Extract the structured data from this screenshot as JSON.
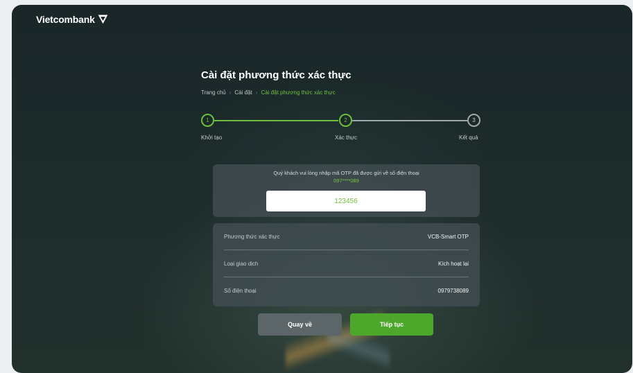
{
  "brand": {
    "name": "Vietcombank"
  },
  "page": {
    "title": "Cài đặt phương thức xác thực",
    "breadcrumb": [
      "Trang chủ",
      "Cài đặt",
      "Cài đặt phương thức xác thực"
    ]
  },
  "stepper": {
    "steps": [
      {
        "number": "1",
        "label": "Khởi tạo",
        "state": "done"
      },
      {
        "number": "2",
        "label": "Xác thực",
        "state": "active"
      },
      {
        "number": "3",
        "label": "Kết quả",
        "state": "pending"
      }
    ]
  },
  "otp": {
    "message": "Quý khách vui lòng nhập mã OTP đã được gửi về số điện thoại",
    "phone_masked": "097****089",
    "value": "123456"
  },
  "info": {
    "rows": [
      {
        "label": "Phương thức xác thực",
        "value": "VCB-Smart OTP"
      },
      {
        "label": "Loại giao dịch",
        "value": "Kích hoạt lại"
      },
      {
        "label": "Số điện thoại",
        "value": "0979738089"
      }
    ]
  },
  "actions": {
    "back_label": "Quay về",
    "next_label": "Tiếp tục"
  },
  "colors": {
    "accent": "#6fbf3f",
    "primary_button": "#4da72b",
    "secondary_button": "#5c6669"
  }
}
